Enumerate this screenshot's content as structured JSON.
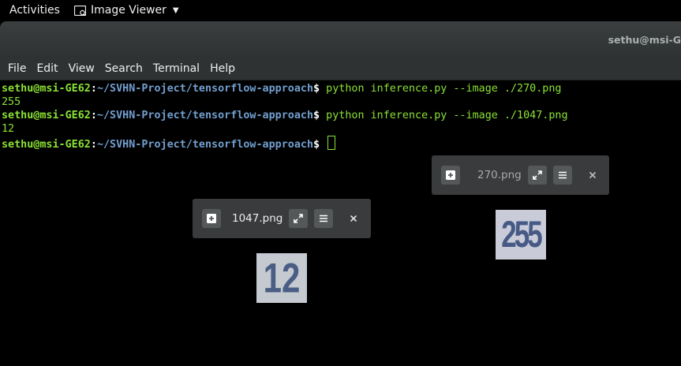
{
  "topbar": {
    "activities": "Activities",
    "app_name": "Image Viewer"
  },
  "window": {
    "title": "sethu@msi-G"
  },
  "menu": [
    "File",
    "Edit",
    "View",
    "Search",
    "Terminal",
    "Help"
  ],
  "terminal": {
    "prompt_user": "sethu@msi-GE62",
    "prompt_colon": ":",
    "prompt_path": "~/SVHN-Project/tensorflow-approach",
    "prompt_symbol": "$ ",
    "lines": [
      {
        "command": "python inference.py --image ./270.png"
      },
      {
        "output": "255"
      },
      {
        "command": "python inference.py --image ./1047.png"
      },
      {
        "output": "12"
      },
      {
        "command": ""
      }
    ]
  },
  "viewer_270": {
    "filename": "270.png",
    "image_text": "255",
    "colors": {
      "bg": "#c9ccd8",
      "digits": "#475a86"
    }
  },
  "viewer_1047": {
    "filename": "1047.png",
    "image_text": "12",
    "colors": {
      "bg": "#c4cad0",
      "digits": "#4a5d84"
    }
  }
}
